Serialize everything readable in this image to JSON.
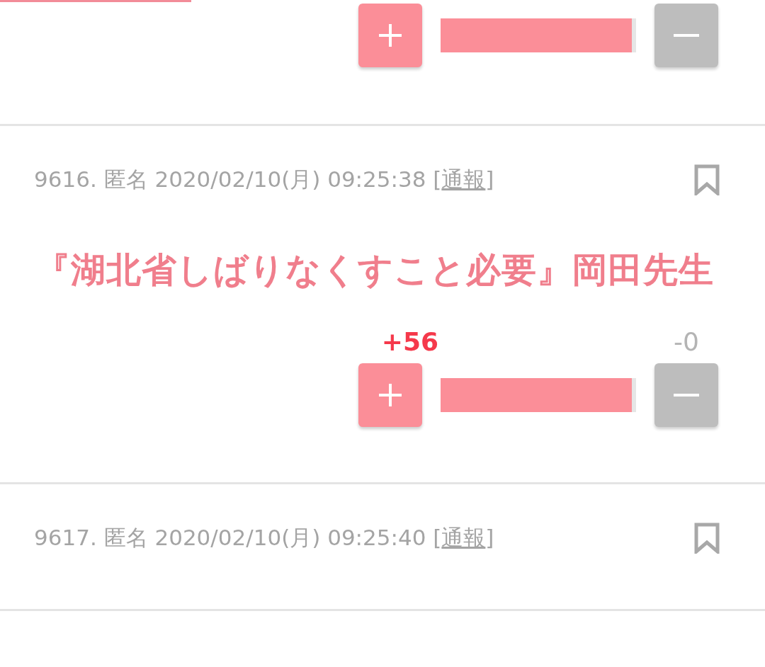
{
  "posts": [
    {
      "vote": {
        "level": 1
      }
    },
    {
      "number": "9616.",
      "author": "匿名",
      "date": "2020/02/10(月) 09:25:38",
      "bracket_open": "[",
      "report": "通報",
      "bracket_close": "]",
      "body": "『湖北省しばりなくすこと必要』岡田先生",
      "plus_count": "+56",
      "minus_count": "-0",
      "vote": {
        "level": 1
      }
    },
    {
      "number": "9617.",
      "author": "匿名",
      "date": "2020/02/10(月) 09:25:40",
      "bracket_open": "[",
      "report": "通報",
      "bracket_close": "]"
    }
  ]
}
